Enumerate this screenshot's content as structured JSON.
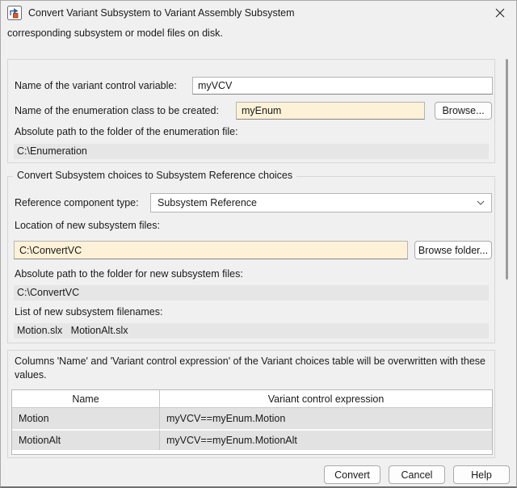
{
  "window": {
    "title": "Convert Variant Subsystem to Variant Assembly Subsystem"
  },
  "intro_text": "corresponding subsystem or model files on disk.",
  "section1": {
    "variant_control_label": "Name of the variant control variable:",
    "variant_control_value": "myVCV",
    "enum_class_label": "Name of the enumeration class to be created:",
    "enum_class_value": "myEnum",
    "browse_button": "Browse...",
    "enum_path_label": "Absolute path to the folder of the enumeration file:",
    "enum_path_value": "C:\\Enumeration"
  },
  "section2": {
    "legend": "Convert Subsystem choices to Subsystem Reference choices",
    "ref_type_label": "Reference component type:",
    "ref_type_value": "Subsystem Reference",
    "location_label": "Location of new subsystem files:",
    "location_value": "C:\\ConvertVC",
    "browse_folder_button": "Browse folder...",
    "abs_path_label": "Absolute path to the folder for new subsystem files:",
    "abs_path_value": "C:\\ConvertVC",
    "filenames_label": "List of new subsystem filenames:",
    "filenames_value": "Motion.slx   MotionAlt.slx"
  },
  "section3": {
    "note": "Columns 'Name' and 'Variant control expression' of the Variant choices table will be overwritten with these values.",
    "table": {
      "columns": [
        "Name",
        "Variant control expression"
      ],
      "rows": [
        {
          "name": "Motion",
          "expression": "myVCV==myEnum.Motion"
        },
        {
          "name": "MotionAlt",
          "expression": "myVCV==myEnum.MotionAlt"
        }
      ]
    }
  },
  "footer": {
    "convert": "Convert",
    "cancel": "Cancel",
    "help": "Help"
  },
  "colors": {
    "bg": "#f0f0f0",
    "cream": "#fdf2d7",
    "rofield": "#e6e6e6",
    "rowgrey": "#e2e2e2"
  }
}
